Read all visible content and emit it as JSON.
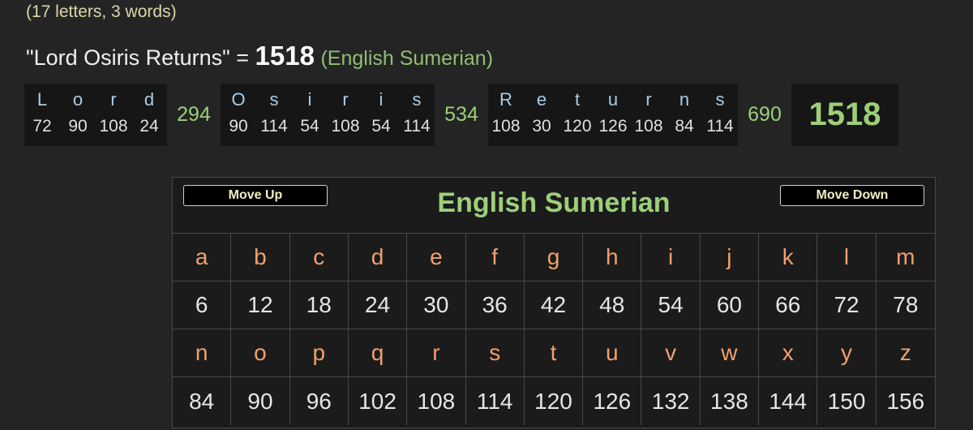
{
  "summary": {
    "count_text": "(17 letters, 3 words)"
  },
  "phrase": {
    "text": "\"Lord Osiris Returns\" = ",
    "total": "1518",
    "cipher": "(English Sumerian)"
  },
  "breakdown": {
    "words": [
      {
        "letters": [
          "L",
          "o",
          "r",
          "d"
        ],
        "values": [
          "72",
          "90",
          "108",
          "24"
        ],
        "sum": "294"
      },
      {
        "letters": [
          "O",
          "s",
          "i",
          "r",
          "i",
          "s"
        ],
        "values": [
          "90",
          "114",
          "54",
          "108",
          "54",
          "114"
        ],
        "sum": "534"
      },
      {
        "letters": [
          "R",
          "e",
          "t",
          "u",
          "r",
          "n",
          "s"
        ],
        "values": [
          "108",
          "30",
          "120",
          "126",
          "108",
          "84",
          "114"
        ],
        "sum": "690"
      }
    ],
    "total": "1518"
  },
  "cipher_table": {
    "move_up_label": "Move Up",
    "move_down_label": "Move Down",
    "title": "English Sumerian",
    "letters": [
      "a",
      "b",
      "c",
      "d",
      "e",
      "f",
      "g",
      "h",
      "i",
      "j",
      "k",
      "l",
      "m",
      "n",
      "o",
      "p",
      "q",
      "r",
      "s",
      "t",
      "u",
      "v",
      "w",
      "x",
      "y",
      "z"
    ],
    "values": [
      "6",
      "12",
      "18",
      "24",
      "30",
      "36",
      "42",
      "48",
      "54",
      "60",
      "66",
      "72",
      "78",
      "84",
      "90",
      "96",
      "102",
      "108",
      "114",
      "120",
      "126",
      "132",
      "138",
      "144",
      "150",
      "156"
    ]
  },
  "colors": {
    "accent_green": "#9dcf7a",
    "letter_orange": "#f0a06c",
    "letter_blue": "#a8cdea",
    "count_yellow": "#dcd6a8"
  }
}
